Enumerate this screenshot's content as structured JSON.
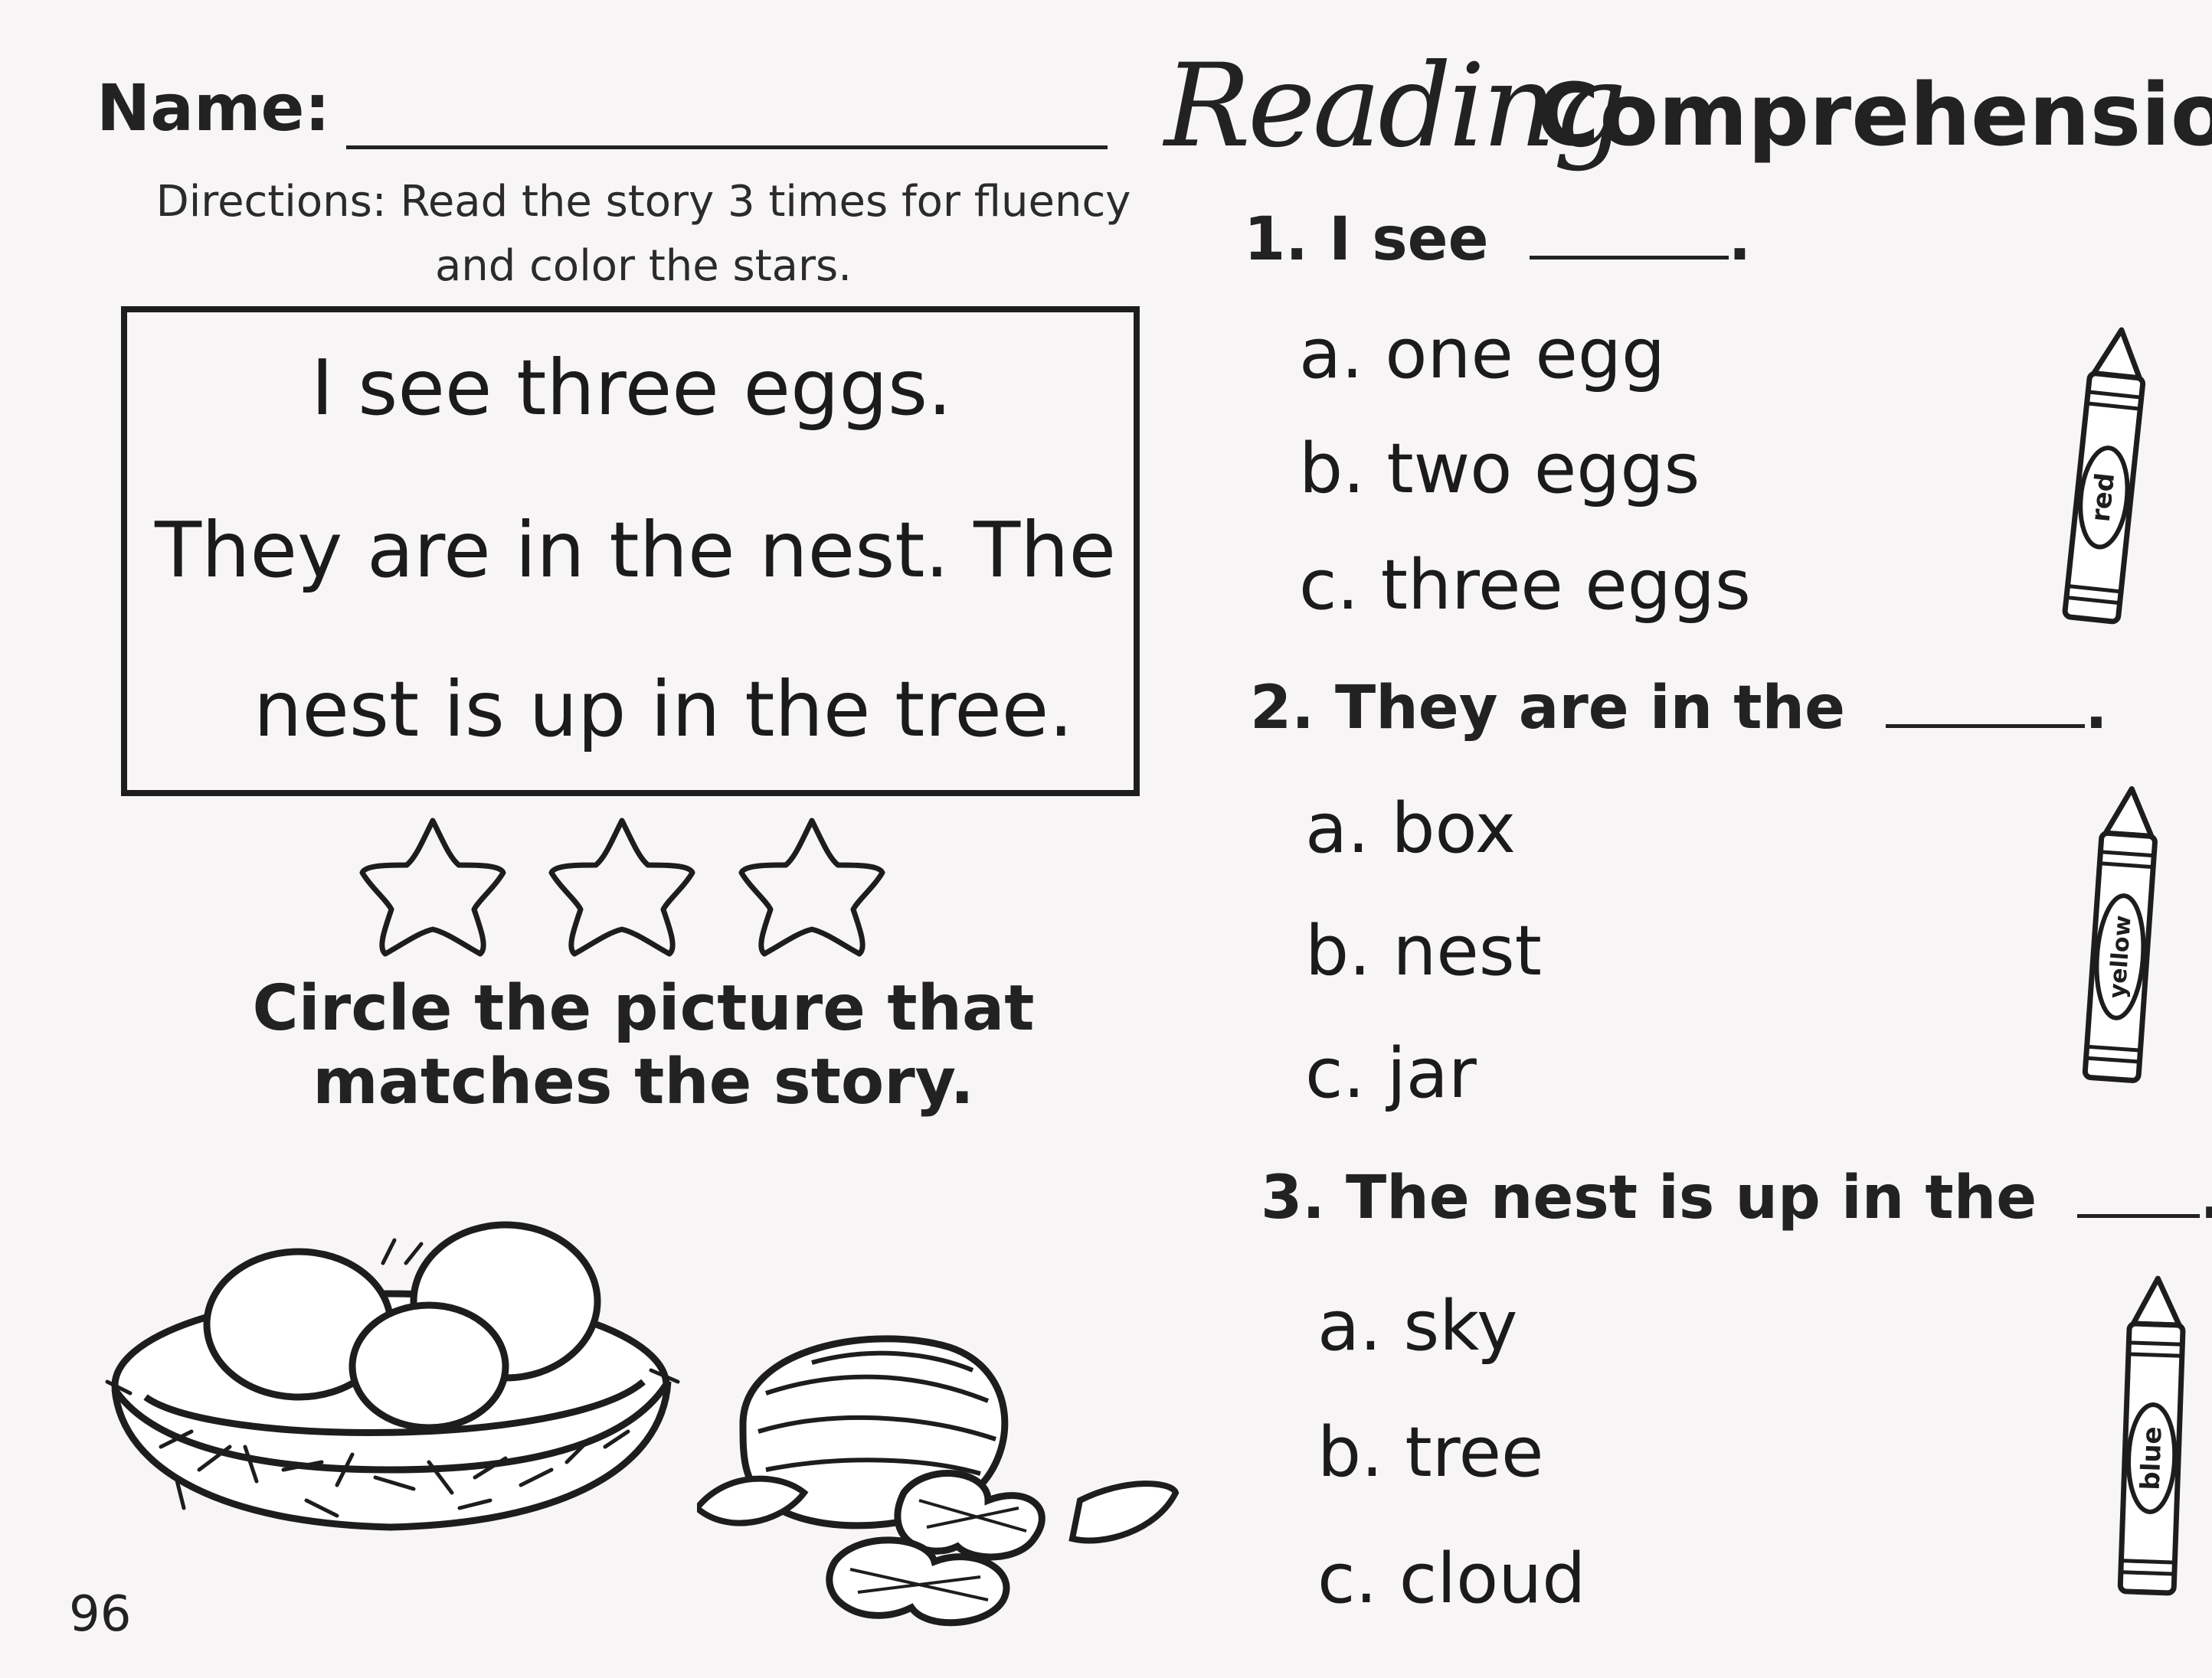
{
  "header": {
    "name_label": "Name:",
    "title_script": "Reading",
    "title_bold": "Comprehension"
  },
  "directions": "Directions: Read the story 3 times for fluency and color the stars.",
  "story": {
    "lines": [
      "I see three eggs.",
      "They are in the nest. The",
      "nest is up in the tree."
    ]
  },
  "stars_count": 3,
  "circle_instruction": "Circle the picture that matches the story.",
  "page_number": "96",
  "questions": [
    {
      "prompt": "1. I see",
      "end": ".",
      "options": [
        "a. one egg",
        "b. two eggs",
        "c. three eggs"
      ],
      "crayon_label": "red",
      "crayon_icon": "crayon-icon"
    },
    {
      "prompt": "2. They are in the",
      "end": ".",
      "options": [
        "a. box",
        "b. nest",
        "c. jar"
      ],
      "crayon_label": "yellow",
      "crayon_icon": "crayon-icon"
    },
    {
      "prompt": "3. The nest is up in the",
      "end": ".",
      "options": [
        "a. sky",
        "b. tree",
        "c. cloud"
      ],
      "crayon_label": "blue",
      "crayon_icon": "crayon-icon"
    }
  ],
  "pictures": [
    "bird-nest-with-eggs-icon",
    "nuts-icon"
  ],
  "colors": {
    "ink": "#1d1d1d",
    "paper": "#f7f5f6"
  }
}
